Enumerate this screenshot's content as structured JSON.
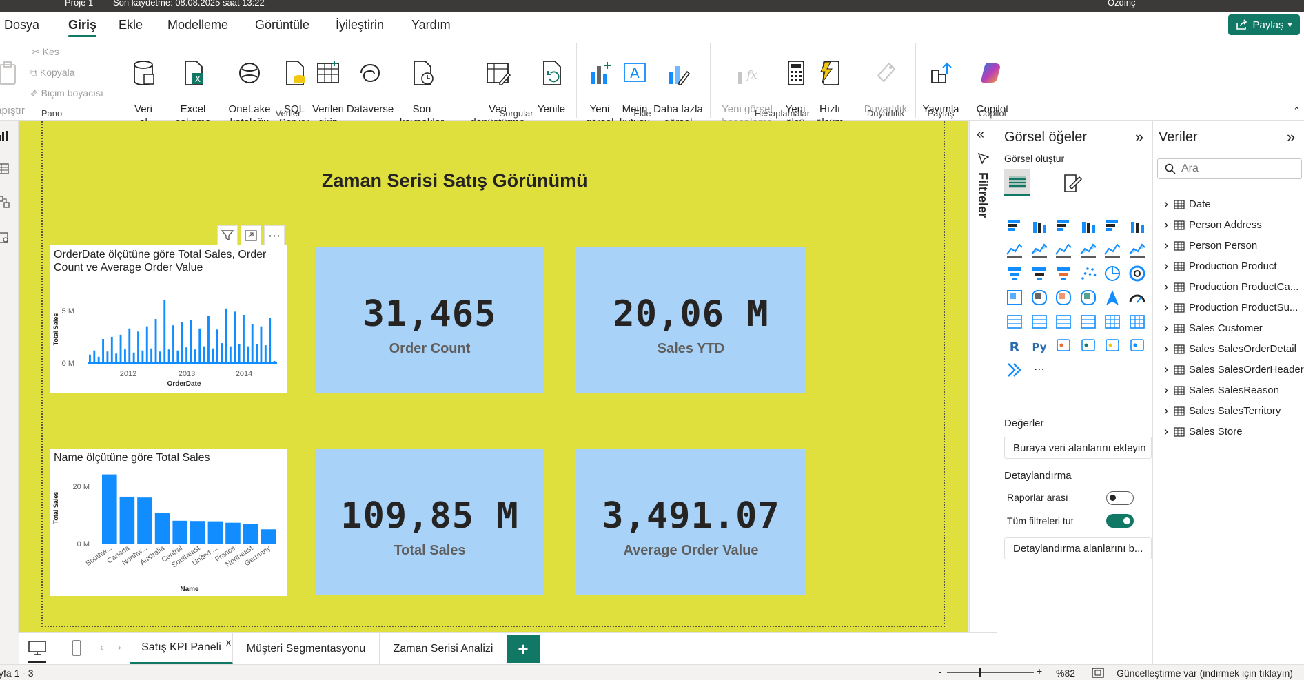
{
  "titlebar": {
    "doc_name": "Proje 1",
    "save_status": "Son kaydetme: 08.08.2025 saat 13:22",
    "user": "Ozdinç"
  },
  "menu": {
    "items": [
      "Dosya",
      "Giriş",
      "Ekle",
      "Modelleme",
      "Görüntüle",
      "İyileştirin",
      "Yardım"
    ],
    "share_label": "Paylaş"
  },
  "ribbon": {
    "clipboard": {
      "paste": "apıştır",
      "cut": "Kes",
      "copy": "Kopyala",
      "format_painter": "Biçim boyacısı",
      "group": "Pano"
    },
    "data": {
      "get_data": "Veri\nal",
      "excel": "Excel çalışma\nkitabı",
      "onelake": "OneLake\nkataloğu",
      "sql": "SQL\nServer",
      "enter_data": "Verileri\ngirin",
      "dataverse": "Dataverse",
      "recent": "Son\nkaynaklar",
      "group": "Veriler"
    },
    "queries": {
      "transform": "Veri\ndönüştürme",
      "refresh": "Yenile",
      "group": "Sorgular"
    },
    "insert": {
      "new_visual": "Yeni\ngörsel",
      "text_box": "Metin\nkutusu",
      "more_visuals": "Daha fazla\ngörsel",
      "group": "Ekle"
    },
    "calculations": {
      "new_visual_calc": "Yeni görsel\nhesaplama",
      "new_measure": "Yeni\nölçü",
      "quick_measure": "Hızlı\nölçüm",
      "group": "Hesaplamalar"
    },
    "sensitivity": {
      "label": "Duyarlılık",
      "group": "Duyarlılık"
    },
    "share": {
      "publish": "Yayımla",
      "group": "Paylaş"
    },
    "copilot": {
      "label": "Copilot",
      "group": "Copilot"
    }
  },
  "report": {
    "title": "Zaman Serisi Satış Görünümü",
    "line_visual": {
      "title": "OrderDate ölçütüne göre Total Sales, Order Count ve Average Order Value"
    },
    "bar_visual": {
      "title": "Name ölçütüne göre Total Sales"
    },
    "cards": [
      {
        "value": "31,465",
        "label": "Order Count"
      },
      {
        "value": "20,06 M",
        "label": "Sales YTD"
      },
      {
        "value": "109,85 M",
        "label": "Total Sales"
      },
      {
        "value": "3,491.07",
        "label": "Average Order Value"
      }
    ]
  },
  "chart_data": [
    {
      "type": "bar",
      "title": "OrderDate ölçütüne göre Total Sales, Order Count ve Average Order Value",
      "xlabel": "OrderDate",
      "ylabel": "Total Sales",
      "yticks": [
        "0 M",
        "5 M"
      ],
      "xticks": [
        "2012",
        "2013",
        "2014"
      ],
      "ylim": [
        0,
        6.5
      ],
      "values": [
        0.8,
        1.2,
        0.6,
        2.3,
        1.1,
        2.5,
        0.9,
        2.7,
        1.3,
        3.3,
        1.0,
        3.0,
        1.2,
        3.5,
        1.4,
        4.2,
        1.1,
        6.0,
        1.3,
        3.6,
        1.2,
        3.9,
        1.5,
        4.1,
        1.3,
        3.3,
        1.6,
        4.5,
        1.4,
        3.2,
        1.9,
        5.2,
        1.6,
        4.9,
        1.8,
        4.6,
        1.6,
        3.7,
        1.8,
        3.5,
        1.7,
        4.3,
        0.2
      ]
    },
    {
      "type": "bar",
      "title": "Name ölçütüne göre Total Sales",
      "xlabel": "Name",
      "ylabel": "Total Sales",
      "yticks": [
        "0 M",
        "20 M"
      ],
      "ylim": [
        0,
        30
      ],
      "categories": [
        "Southw...",
        "Canada",
        "Northw...",
        "Australia",
        "Central",
        "Southeast",
        "United ...",
        "France",
        "Northeast",
        "Germany"
      ],
      "values": [
        24.2,
        16.4,
        16.1,
        10.6,
        8.0,
        7.9,
        7.8,
        7.3,
        6.9,
        5.0
      ]
    }
  ],
  "filters_pane": {
    "label": "Filtreler"
  },
  "viz_pane": {
    "title": "Görsel öğeler",
    "build_label": "Görsel oluştur",
    "values_label": "Değerler",
    "values_placeholder": "Buraya veri alanlarını ekleyin",
    "drillthrough_label": "Detaylandırma",
    "cross_report_label": "Raporlar arası",
    "keep_filters_label": "Tüm filtreleri tut",
    "drillthrough_placeholder": "Detaylandırma alanlarını b...",
    "cross_report_on": false,
    "keep_filters_on": true
  },
  "data_pane": {
    "title": "Veriler",
    "search_placeholder": "Ara",
    "tables": [
      "Date",
      "Person Address",
      "Person Person",
      "Production Product",
      "Production ProductCa...",
      "Production ProductSu...",
      "Sales Customer",
      "Sales SalesOrderDetail",
      "Sales SalesOrderHeader",
      "Sales SalesReason",
      "Sales SalesTerritory",
      "Sales Store"
    ]
  },
  "tabs": {
    "items": [
      "Satış KPI Paneli",
      "Müşteri Segmentasyonu",
      "Zaman Serisi Analizi"
    ],
    "add_label": "+",
    "close_label": "x"
  },
  "status": {
    "page": "yfa 1 - 3",
    "zoom": "%82",
    "update": "Güncelleştirme var (indirmek için tıklayın)"
  },
  "colors": {
    "accent": "#117865",
    "page_bg": "#dfe03e",
    "card_bg": "#a8d2f8",
    "bar": "#118dff"
  }
}
